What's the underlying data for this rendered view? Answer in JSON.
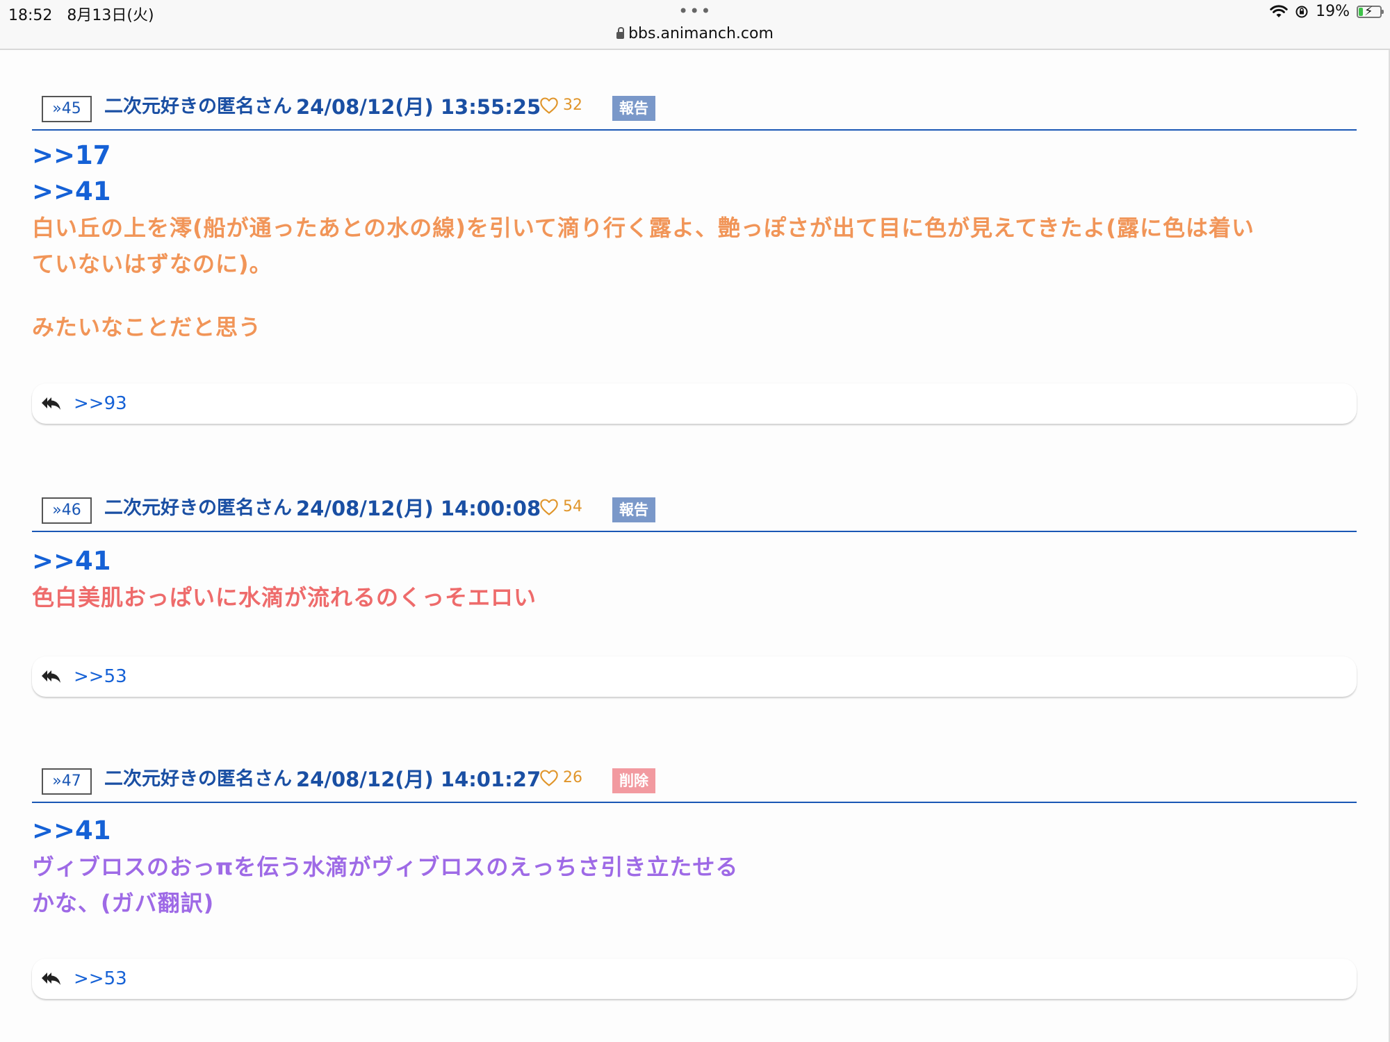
{
  "status_bar": {
    "time": "18:52",
    "date": "8月13日(火)",
    "more": "•••",
    "url": "bbs.animanch.com",
    "battery_percent": "19%",
    "battery_level": 0.19
  },
  "colors": {
    "link_blue": "#1561d6",
    "header_blue": "#1a4fa3",
    "rule_blue": "#1a57b5",
    "like_orange": "#e0952a",
    "report_badge": "#7a98c9",
    "delete_badge": "#f29aa0",
    "text_orange": "#f19558",
    "text_red": "#ee6b6b",
    "text_purple": "#9e6ae6"
  },
  "posts": [
    {
      "number": "»45",
      "poster": "二次元好きの匿名さん",
      "datetime": "24/08/12(月) 13:55:25",
      "likes": "32",
      "badge": "報告",
      "anchors": [
        ">>17",
        ">>41"
      ],
      "lines": [
        "白い丘の上を澪(船が通ったあとの水の線)を引いて滴り行く露よ、艶っぽさが出て目に色が見えてきたよ(露に色は着い",
        "ていないはずなのに)。",
        "みたいなことだと思う"
      ],
      "reply": ">>93"
    },
    {
      "number": "»46",
      "poster": "二次元好きの匿名さん",
      "datetime": "24/08/12(月) 14:00:08",
      "likes": "54",
      "badge": "報告",
      "anchors": [
        ">>41"
      ],
      "lines": [
        "色白美肌おっぱいに水滴が流れるのくっそエロい"
      ],
      "reply": ">>53"
    },
    {
      "number": "»47",
      "poster": "二次元好きの匿名さん",
      "datetime": "24/08/12(月) 14:01:27",
      "likes": "26",
      "badge": "削除",
      "anchors": [
        ">>41"
      ],
      "lines": [
        "ヴィブロスのおっπを伝う水滴がヴィブロスのえっちさ引き立たせる",
        "かな、(ガバ翻訳)"
      ],
      "reply": ">>53"
    }
  ]
}
